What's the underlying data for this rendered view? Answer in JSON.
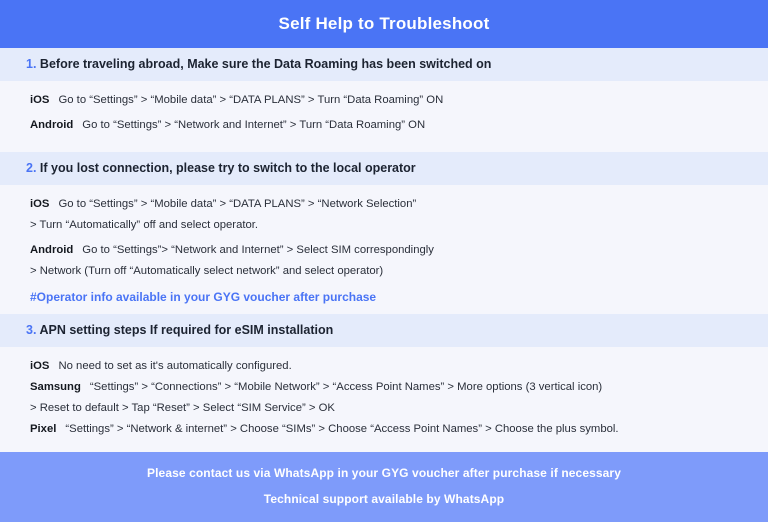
{
  "header": {
    "title": "Self Help to Troubleshoot",
    "bg_color": "#4a74f5",
    "text_color": "#ffffff"
  },
  "accent_color": "#4a74f5",
  "band_color": "#e4ebfb",
  "body_color": "#f5f6fc",
  "footer_color": "#7e9bfa",
  "sections": [
    {
      "number": "1.",
      "title_strong": "Before traveling abroad,",
      "title_rest": " Make sure the Data Roaming has been switched on",
      "lines": [
        {
          "os": "iOS",
          "text": "Go to “Settings” > “Mobile data” > “DATA PLANS” > Turn “Data Roaming” ON"
        },
        {
          "os": "Android",
          "text": "Go to “Settings” > “Network and Internet” > Turn “Data Roaming” ON"
        }
      ]
    },
    {
      "number": "2.",
      "title_strong": "If you lost connection, please try to switch to the local operator",
      "title_rest": "",
      "lines": [
        {
          "os": "iOS",
          "text": "Go to “Settings” > “Mobile data” > “DATA PLANS” > “Network Selection”"
        },
        {
          "os": "",
          "text": "> Turn “Automatically” off and select operator."
        },
        {
          "os": "Android",
          "text": "Go to “Settings”>  “Network and Internet” > Select SIM correspondingly"
        },
        {
          "os": "",
          "text": "> Network (Turn off “Automatically select network” and select operator)"
        }
      ],
      "note": "#Operator info available in your GYG voucher after purchase"
    },
    {
      "number": "3.",
      "title_strong": "APN setting steps If required for eSIM installation",
      "title_rest": "",
      "lines": [
        {
          "os": "iOS",
          "text": "No need to set as it's automatically configured."
        },
        {
          "os": "Samsung",
          "text": "“Settings” > “Connections” > “Mobile Network” > “Access Point Names” > More options (3 vertical icon)"
        },
        {
          "os": "",
          "text": "> Reset to default > Tap “Reset” > Select “SIM Service” > OK"
        },
        {
          "os": "Pixel",
          "text": "“Settings” > “Network & internet” > Choose “SIMs” > Choose “Access Point Names” > Choose the plus symbol."
        }
      ]
    }
  ],
  "footer": {
    "line1": "Please contact us via WhatsApp  in your GYG voucher after purchase if necessary",
    "line2": "Technical support available by WhatsApp"
  }
}
